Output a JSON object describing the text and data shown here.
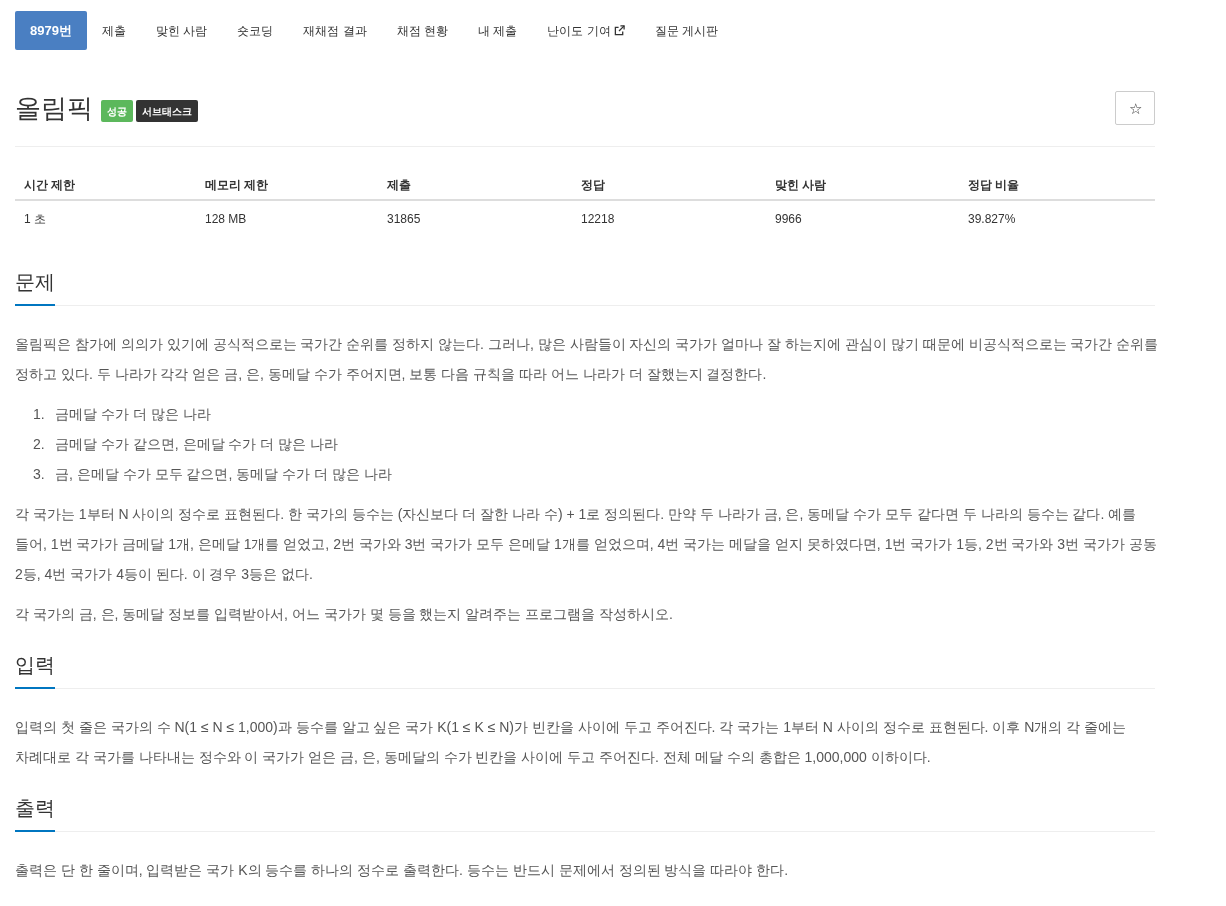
{
  "tabs": [
    {
      "label": "8979번",
      "selected": true,
      "external": false
    },
    {
      "label": "제출",
      "selected": false,
      "external": false
    },
    {
      "label": "맞힌 사람",
      "selected": false,
      "external": false
    },
    {
      "label": "숏코딩",
      "selected": false,
      "external": false
    },
    {
      "label": "재채점 결과",
      "selected": false,
      "external": false
    },
    {
      "label": "채점 현황",
      "selected": false,
      "external": false
    },
    {
      "label": "내 제출",
      "selected": false,
      "external": false
    },
    {
      "label": "난이도 기여",
      "selected": false,
      "external": true
    },
    {
      "label": "질문 게시판",
      "selected": false,
      "external": false
    }
  ],
  "problem_title": "올림픽",
  "labels": [
    {
      "text": "성공",
      "color": "#5cb85c"
    },
    {
      "text": "서브태스크",
      "color": "#333333"
    }
  ],
  "star_button": {
    "label": "☆"
  },
  "info_table": {
    "columns": [
      "시간 제한",
      "메모리 제한",
      "제출",
      "정답",
      "맞힌 사람",
      "정답 비율"
    ],
    "rows": [
      [
        "1 초",
        "128 MB",
        "31865",
        "12218",
        "9966",
        "39.827%"
      ]
    ]
  },
  "sections": [
    {
      "heading": "문제",
      "blocks": [
        {
          "kind": "paragraph",
          "text": "올림픽은 참가에 의의가 있기에 공식적으로는 국가간 순위를 정하지 않는다. 그러나, 많은 사람들이 자신의 국가가 얼마나 잘 하는지에 관심이 많기 때문에 비공식적으로는 국가간 순위를 정하고 있다. 두 나라가 각각 얻은 금, 은, 동메달 수가 주어지면, 보통 다음 규칙을 따라 어느 나라가 더 잘했는지 결정한다."
        },
        {
          "kind": "ordered_list",
          "items": [
            {
              "number": "1.",
              "text": "금메달 수가 더 많은 나라"
            },
            {
              "number": "2.",
              "text": "금메달 수가 같으면, 은메달 수가 더 많은 나라"
            },
            {
              "number": "3.",
              "text": "금, 은메달 수가 모두 같으면, 동메달 수가 더 많은 나라"
            }
          ]
        },
        {
          "kind": "paragraph",
          "text": "각 국가는 1부터 N 사이의 정수로 표현된다. 한 국가의 등수는 (자신보다 더 잘한 나라 수) + 1로 정의된다. 만약 두 나라가 금, 은, 동메달 수가 모두 같다면 두 나라의 등수는 같다. 예를 들어, 1번 국가가 금메달 1개, 은메달 1개를 얻었고, 2번 국가와 3번 국가가 모두 은메달 1개를 얻었으며, 4번 국가는 메달을 얻지 못하였다면, 1번 국가가 1등, 2번 국가와 3번 국가가 공동 2등, 4번 국가가 4등이 된다. 이 경우 3등은 없다."
        },
        {
          "kind": "paragraph",
          "text": "각 국가의 금, 은, 동메달 정보를 입력받아서, 어느 국가가 몇 등을 했는지 알려주는 프로그램을 작성하시오."
        }
      ]
    },
    {
      "heading": "입력",
      "blocks": [
        {
          "kind": "paragraph",
          "text": "입력의 첫 줄은 국가의 수 N(1 ≤ N ≤ 1,000)과 등수를 알고 싶은 국가 K(1 ≤ K ≤ N)가 빈칸을 사이에 두고 주어진다. 각 국가는 1부터 N 사이의 정수로 표현된다. 이후 N개의 각 줄에는 차례대로 각 국가를 나타내는 정수와 이 국가가 얻은 금, 은, 동메달의 수가 빈칸을 사이에 두고 주어진다. 전체 메달 수의 총합은 1,000,000 이하이다."
        }
      ]
    },
    {
      "heading": "출력",
      "blocks": [
        {
          "kind": "paragraph",
          "text": "출력은 단 한 줄이며, 입력받은 국가 K의 등수를 하나의 정수로 출력한다. 등수는 반드시 문제에서 정의된 방식을 따라야 한다."
        }
      ]
    }
  ]
}
